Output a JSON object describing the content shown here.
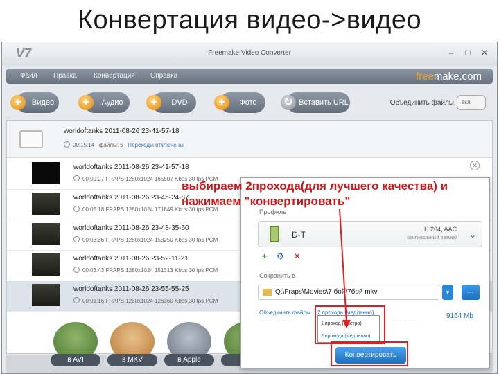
{
  "slide_title": "Конвертация видео->видео",
  "window": {
    "title": "Freemake Video Converter",
    "controls": [
      "–",
      "□",
      "✕"
    ]
  },
  "menu": [
    "Файл",
    "Правка",
    "Конвертация",
    "Справка"
  ],
  "brand": {
    "part1": "free",
    "part2": "make.com"
  },
  "toolbar": {
    "buttons": [
      "Видео",
      "Аудио",
      "DVD",
      "Фото",
      "Вставить URL"
    ],
    "merge_label": "Объединить файлы",
    "merge_toggle": "вкл"
  },
  "group": {
    "name": "worldoftanks 2011-08-26 23-41-57-18",
    "duration": "00:15:14",
    "files": "файлы: 5",
    "transitions": "Переходы отключены"
  },
  "rows": [
    {
      "name": "worldoftanks 2011-08-26 23-41-57-18",
      "meta": "00:09:27   FRAPS  1280x1024  165507 Kbps  30 fps   PCM"
    },
    {
      "name": "worldoftanks 2011-08-26 23-45-24-87",
      "meta": "00:05:18   FRAPS  1280x1024  171849 Kbps  30 fps   PCM"
    },
    {
      "name": "worldoftanks 2011-08-26 23-48-35-60",
      "meta": "00:03:36   FRAPS  1280x1024  153250 Kbps  30 fps   PCM"
    },
    {
      "name": "worldoftanks 2011-08-26 23-52-11-21",
      "meta": "00:03:43   FRAPS  1280x1024  151313 Kbps  30 fps   PCM"
    },
    {
      "name": "worldoftanks 2011-08-26 23-55-55-25",
      "meta": "00:01:16   FRAPS  1280x1024  126360 Kbps  30 fps   PCM"
    }
  ],
  "outputs": [
    "в AVI",
    "в MKV",
    "в Apple",
    "в A"
  ],
  "panel": {
    "profile_label": "Профиль",
    "profile_name": "D-T",
    "profile_codec": "H.264, AAC",
    "profile_size": "оригинальный размер",
    "save_label": "Сохранить в",
    "save_path": "Q:\\Fraps\\Movies\\7 бой\\7бой mkv",
    "more": "...",
    "merge_link": "Объединить файлы",
    "pass_selected": "2 прохода (медленно)",
    "pass_options": [
      "1 проход (быстро)",
      "2 прохода (медленно)"
    ],
    "size": "9164 Mb",
    "convert": "Конвертировать"
  },
  "annotation": "выбираем 2прохода(для лучшего качества) и нажимаем \"конвертировать\""
}
